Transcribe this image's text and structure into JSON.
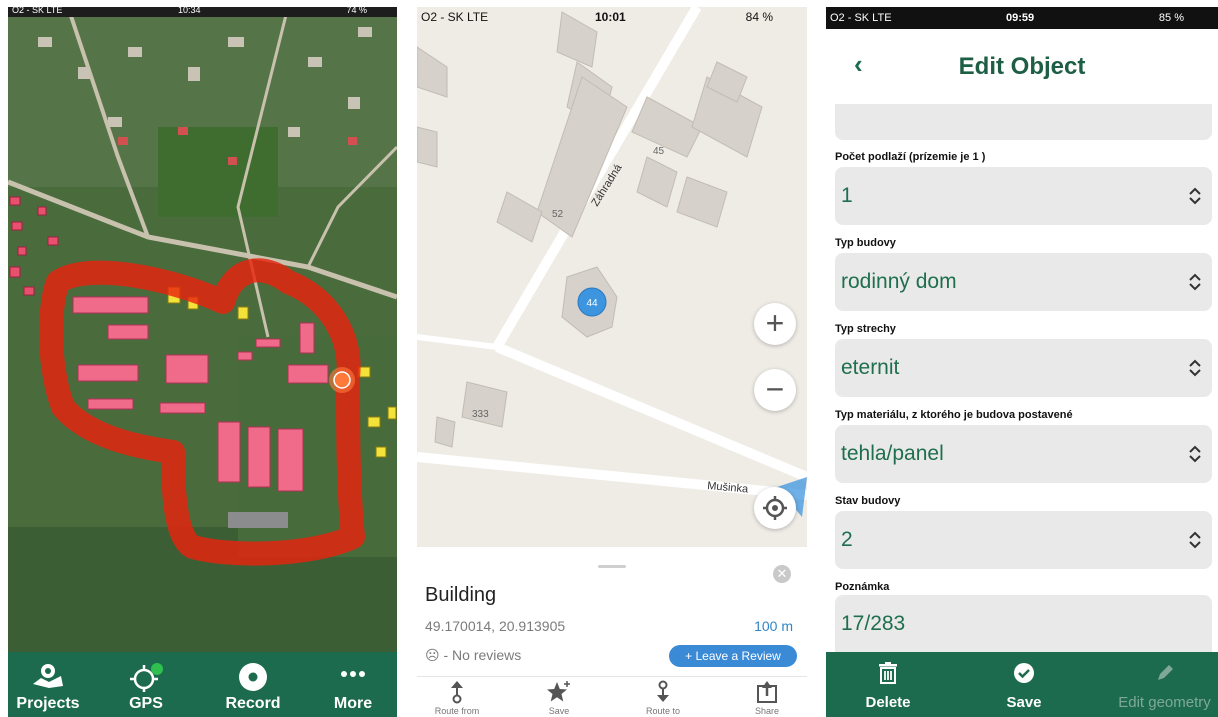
{
  "phone1": {
    "status": {
      "carrier": "O2 - SK  LTE",
      "time": "10:34",
      "battery": "74 %"
    },
    "tabs": [
      {
        "label": "Projects",
        "icon": "map-pin-icon"
      },
      {
        "label": "GPS",
        "icon": "crosshair-icon",
        "status_color": "#2fbf4f"
      },
      {
        "label": "Record",
        "icon": "record-icon"
      },
      {
        "label": "More",
        "icon": "more-icon"
      }
    ]
  },
  "phone2": {
    "status": {
      "carrier": "O2 - SK  LTE",
      "time": "10:01",
      "battery": "84 %"
    },
    "map": {
      "street_1": "Záhradná",
      "street_2": "Mušinka",
      "house_45": "45",
      "house_52": "52",
      "house_333": "333",
      "marker": "44"
    },
    "zoom_in": "+",
    "zoom_out": "−",
    "sheet": {
      "title": "Building",
      "coords": "49.170014, 20.913905",
      "distance": "100 m",
      "reviews": "☹ - No reviews",
      "leave_review": "+ Leave a Review",
      "close": "✕"
    },
    "actions": [
      {
        "label": "Route from",
        "icon": "route-from-icon"
      },
      {
        "label": "Save",
        "icon": "star-icon"
      },
      {
        "label": "Route to",
        "icon": "route-to-icon"
      },
      {
        "label": "Share",
        "icon": "share-icon"
      }
    ]
  },
  "phone3": {
    "status": {
      "carrier": "O2 - SK  LTE",
      "time": "09:59",
      "battery": "85 %"
    },
    "nav": {
      "back": "‹",
      "title": "Edit Object"
    },
    "fields": [
      {
        "label": "Počet podlaží (prízemie je 1 )",
        "value": "1",
        "has_picker": true
      },
      {
        "label": "Typ budovy",
        "value": "rodinný dom",
        "has_picker": true
      },
      {
        "label": "Typ strechy",
        "value": "eternit",
        "has_picker": true
      },
      {
        "label": "Typ materiálu, z ktorého je budova postavené",
        "value": "tehla/panel",
        "has_picker": true
      },
      {
        "label": "Stav budovy",
        "value": "2",
        "has_picker": true
      },
      {
        "label": "Poznámka",
        "value": "17/283",
        "has_picker": false
      }
    ],
    "bottom": [
      {
        "label": "Delete",
        "icon": "trash-icon",
        "enabled": true
      },
      {
        "label": "Save",
        "icon": "check-circle-icon",
        "enabled": true
      },
      {
        "label": "Edit geometry",
        "icon": "pencil-icon",
        "enabled": false
      }
    ]
  },
  "colors": {
    "brand_green": "#1d6b4e",
    "field_value_green": "#1f6f4e",
    "link_blue": "#2f86c9",
    "track_red": "#e8230f"
  }
}
